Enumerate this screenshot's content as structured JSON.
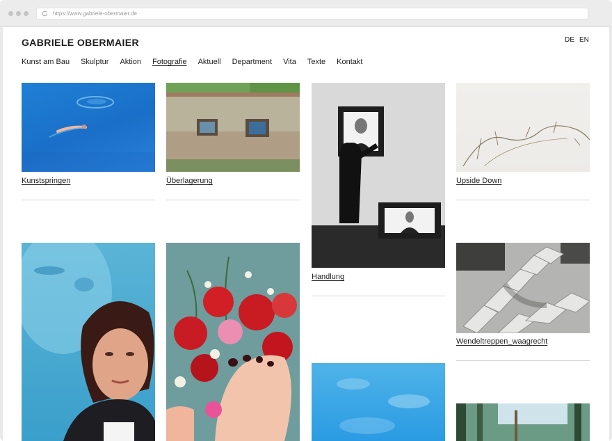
{
  "browser": {
    "url": "https://www.gabriele-obermaier.de"
  },
  "site": {
    "title": "GABRIELE OBERMAIER",
    "languages": [
      "DE",
      "EN"
    ]
  },
  "nav": {
    "items": [
      "Kunst am Bau",
      "Skulptur",
      "Aktion",
      "Fotografie",
      "Aktuell",
      "Department",
      "Vita",
      "Texte",
      "Kontakt"
    ],
    "active": "Fotografie"
  },
  "gallery": {
    "items": [
      {
        "caption": "Kunstspringen",
        "image": "pool-swimmers"
      },
      {
        "caption": "Überlagerung",
        "image": "brick-wall-frames"
      },
      {
        "caption": "Handlung",
        "image": "man-hanging-portrait"
      },
      {
        "caption": "Upside Down",
        "image": "white-branches"
      },
      {
        "caption": "",
        "image": "woman-portrait"
      },
      {
        "caption": "",
        "image": "roses-and-foot"
      },
      {
        "caption": "Wendeltreppen_waagrecht",
        "image": "spiral-stairs"
      },
      {
        "caption": "",
        "image": "blue-sky-clouds"
      },
      {
        "caption": "",
        "image": "forest"
      }
    ]
  },
  "colors": {
    "text": "#1e1e1e",
    "rule": "#d4d4d4",
    "chrome": "#ececec"
  }
}
